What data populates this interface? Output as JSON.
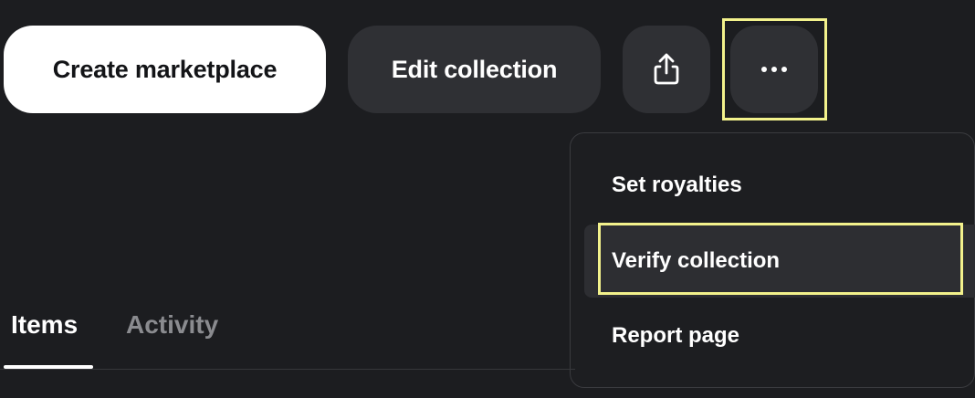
{
  "actions": {
    "create_marketplace": "Create marketplace",
    "edit_collection": "Edit collection",
    "share_icon": "share-icon",
    "more_icon": "ellipsis-icon"
  },
  "more_menu": {
    "items": [
      {
        "label": "Set royalties"
      },
      {
        "label": "Verify collection"
      },
      {
        "label": "Report page"
      }
    ]
  },
  "tabs": [
    {
      "label": "Items",
      "active": true
    },
    {
      "label": "Activity",
      "active": false
    }
  ],
  "colors": {
    "background": "#1c1d20",
    "primary_button": "#ffffff",
    "secondary_button": "#2f3034",
    "highlight": "#f3f28c",
    "inactive_tab": "#8a8b8f"
  }
}
